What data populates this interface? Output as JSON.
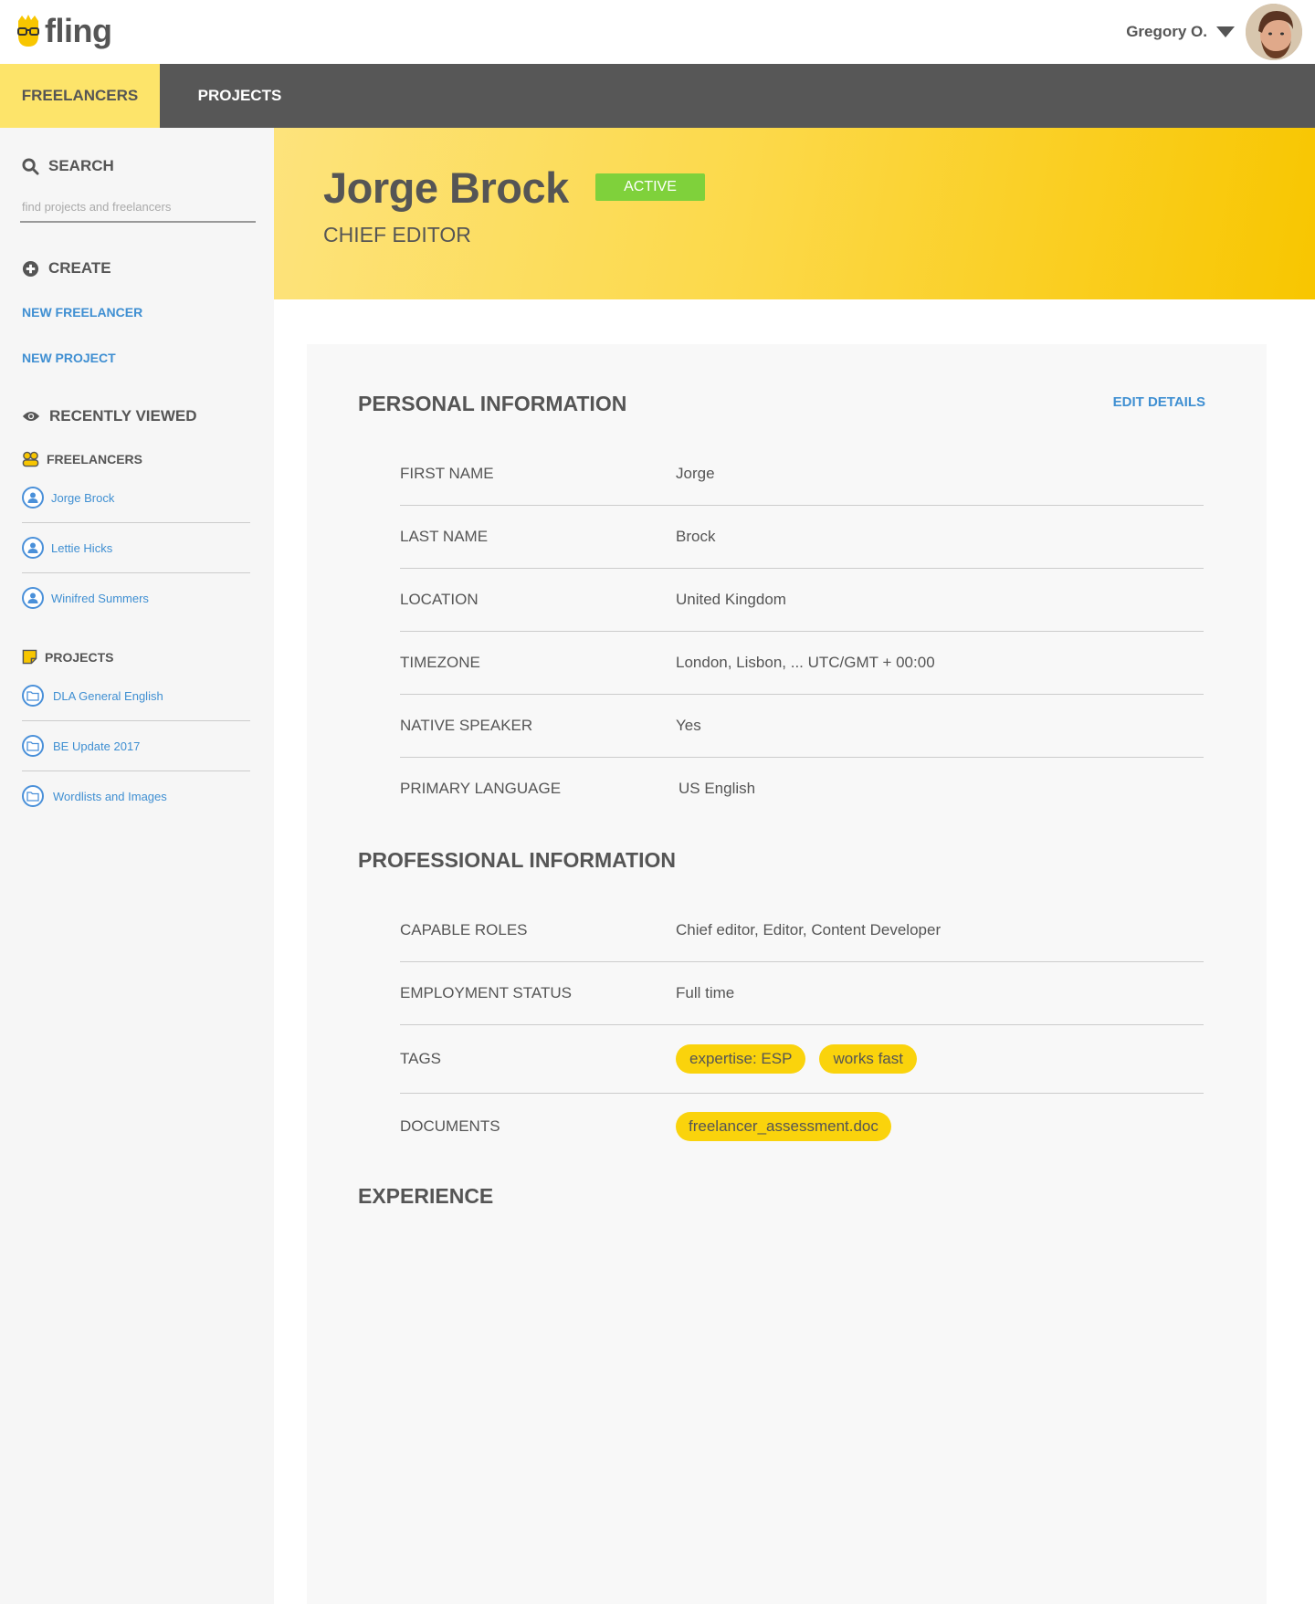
{
  "app": {
    "name": "fling"
  },
  "user": {
    "name": "Gregory O."
  },
  "nav": {
    "tabs": [
      {
        "label": "FREELANCERS"
      },
      {
        "label": "PROJECTS"
      }
    ]
  },
  "sidebar": {
    "search": {
      "label": "SEARCH",
      "placeholder": "find projects and freelancers"
    },
    "create": {
      "label": "CREATE",
      "links": [
        "NEW FREELANCER",
        "NEW PROJECT"
      ]
    },
    "recent": {
      "label": "RECENTLY VIEWED",
      "freelancers": {
        "label": "FREELANCERS",
        "items": [
          "Jorge Brock",
          "Lettie Hicks",
          "Winifred Summers"
        ]
      },
      "projects": {
        "label": "PROJECTS",
        "items": [
          "DLA General English",
          "BE Update 2017",
          "Wordlists and Images"
        ]
      }
    }
  },
  "profile": {
    "name": "Jorge Brock",
    "status": "ACTIVE",
    "role": "CHIEF EDITOR"
  },
  "personal": {
    "title": "PERSONAL INFORMATION",
    "edit_label": "EDIT DETAILS",
    "fields": [
      {
        "label": "FIRST NAME",
        "value": "Jorge"
      },
      {
        "label": "LAST NAME",
        "value": "Brock"
      },
      {
        "label": "LOCATION",
        "value": "United Kingdom"
      },
      {
        "label": "TIMEZONE",
        "value": "London, Lisbon, ... UTC/GMT + 00:00"
      },
      {
        "label": "NATIVE SPEAKER",
        "value": "Yes"
      },
      {
        "label": "PRIMARY LANGUAGE",
        "value": "US English"
      }
    ]
  },
  "professional": {
    "title": "PROFESSIONAL INFORMATION",
    "fields": [
      {
        "label": "CAPABLE ROLES",
        "value": "Chief editor, Editor, Content Developer"
      },
      {
        "label": "EMPLOYMENT STATUS",
        "value": "Full time"
      }
    ],
    "tags_label": "TAGS",
    "tags": [
      "expertise: ESP",
      "works fast"
    ],
    "documents_label": "DOCUMENTS",
    "documents": [
      "freelancer_assessment.doc"
    ]
  },
  "experience": {
    "title": "EXPERIENCE"
  },
  "colors": {
    "accent": "#fad30c",
    "link": "#3f8fd2",
    "status_active": "#7fd13b",
    "nav": "#575757"
  }
}
